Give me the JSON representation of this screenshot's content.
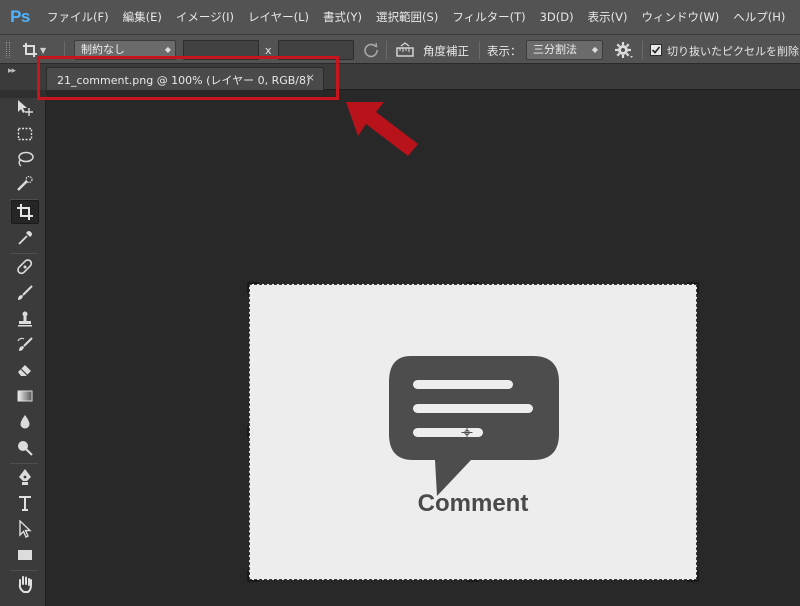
{
  "app": {
    "logo": "Ps"
  },
  "menu": {
    "items": [
      "ファイル(F)",
      "編集(E)",
      "イメージ(I)",
      "レイヤー(L)",
      "書式(Y)",
      "選択範囲(S)",
      "フィルター(T)",
      "3D(D)",
      "表示(V)",
      "ウィンドウ(W)",
      "ヘルプ(H)"
    ]
  },
  "options": {
    "ratio_value": "制約なし",
    "width_value": "",
    "x_label": "x",
    "height_value": "",
    "straighten_label": "角度補正",
    "view_label": "表示：",
    "view_value": "三分割法",
    "delete_cropped_label": "切り抜いたピクセルを削除",
    "delete_cropped_checked": true
  },
  "tab": {
    "title": "21_comment.png @ 100% (レイヤー 0, RGB/8)",
    "close": "×"
  },
  "document": {
    "comment_text": "Comment",
    "bg_color": "#ededed",
    "icon_color": "#4d4d4d"
  },
  "annotation": {
    "color": "#c8141c"
  },
  "tools": [
    "move-tool-icon",
    "marquee-tool-icon",
    "lasso-tool-icon",
    "quick-select-tool-icon",
    "crop-tool-icon",
    "eyedropper-tool-icon",
    "healing-brush-tool-icon",
    "brush-tool-icon",
    "clone-stamp-tool-icon",
    "history-brush-tool-icon",
    "eraser-tool-icon",
    "gradient-tool-icon",
    "blur-tool-icon",
    "dodge-tool-icon",
    "pen-tool-icon",
    "type-tool-icon",
    "path-select-tool-icon",
    "rectangle-tool-icon",
    "hand-tool-icon"
  ]
}
